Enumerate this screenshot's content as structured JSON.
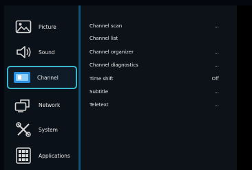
{
  "sidebar": {
    "items": [
      {
        "label": "Picture",
        "icon": "picture-icon",
        "selected": false
      },
      {
        "label": "Sound",
        "icon": "speaker-icon",
        "selected": false
      },
      {
        "label": "Channel",
        "icon": "tv-channel-icon",
        "selected": true
      },
      {
        "label": "Network",
        "icon": "network-icon",
        "selected": false
      },
      {
        "label": "System",
        "icon": "tools-icon",
        "selected": false
      },
      {
        "label": "Applications",
        "icon": "applications-icon",
        "selected": false
      }
    ]
  },
  "channel_menu": {
    "rows": [
      {
        "label": "Channel scan",
        "value": "..."
      },
      {
        "label": "Channel list",
        "value": ""
      },
      {
        "label": "Channel organizer",
        "value": "..."
      },
      {
        "label": "Channel diagnostics",
        "value": "..."
      },
      {
        "label": "Time shift",
        "value": "Off"
      },
      {
        "label": "Subtitle",
        "value": "..."
      },
      {
        "label": "Teletext",
        "value": "..."
      }
    ]
  },
  "colors": {
    "accent": "#39b5cc",
    "panel": "#0d1218",
    "sidebar": "#0b1119",
    "background": "#04070d"
  }
}
